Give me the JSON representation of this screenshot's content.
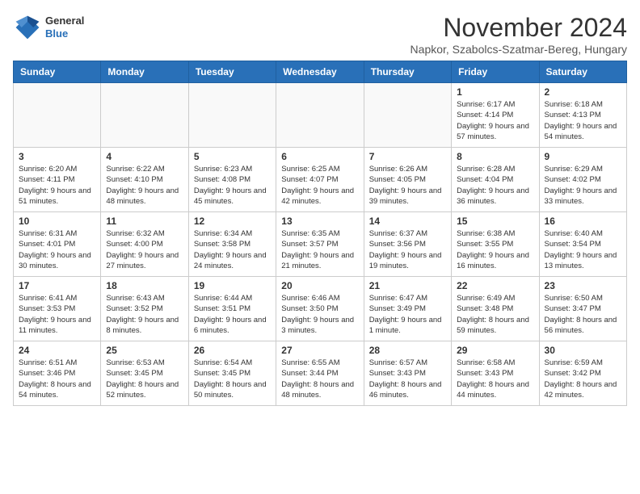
{
  "header": {
    "logo_line1": "General",
    "logo_line2": "Blue",
    "month": "November 2024",
    "location": "Napkor, Szabolcs-Szatmar-Bereg, Hungary"
  },
  "days_of_week": [
    "Sunday",
    "Monday",
    "Tuesday",
    "Wednesday",
    "Thursday",
    "Friday",
    "Saturday"
  ],
  "weeks": [
    [
      {
        "day": "",
        "info": ""
      },
      {
        "day": "",
        "info": ""
      },
      {
        "day": "",
        "info": ""
      },
      {
        "day": "",
        "info": ""
      },
      {
        "day": "",
        "info": ""
      },
      {
        "day": "1",
        "info": "Sunrise: 6:17 AM\nSunset: 4:14 PM\nDaylight: 9 hours\nand 57 minutes."
      },
      {
        "day": "2",
        "info": "Sunrise: 6:18 AM\nSunset: 4:13 PM\nDaylight: 9 hours\nand 54 minutes."
      }
    ],
    [
      {
        "day": "3",
        "info": "Sunrise: 6:20 AM\nSunset: 4:11 PM\nDaylight: 9 hours\nand 51 minutes."
      },
      {
        "day": "4",
        "info": "Sunrise: 6:22 AM\nSunset: 4:10 PM\nDaylight: 9 hours\nand 48 minutes."
      },
      {
        "day": "5",
        "info": "Sunrise: 6:23 AM\nSunset: 4:08 PM\nDaylight: 9 hours\nand 45 minutes."
      },
      {
        "day": "6",
        "info": "Sunrise: 6:25 AM\nSunset: 4:07 PM\nDaylight: 9 hours\nand 42 minutes."
      },
      {
        "day": "7",
        "info": "Sunrise: 6:26 AM\nSunset: 4:05 PM\nDaylight: 9 hours\nand 39 minutes."
      },
      {
        "day": "8",
        "info": "Sunrise: 6:28 AM\nSunset: 4:04 PM\nDaylight: 9 hours\nand 36 minutes."
      },
      {
        "day": "9",
        "info": "Sunrise: 6:29 AM\nSunset: 4:02 PM\nDaylight: 9 hours\nand 33 minutes."
      }
    ],
    [
      {
        "day": "10",
        "info": "Sunrise: 6:31 AM\nSunset: 4:01 PM\nDaylight: 9 hours\nand 30 minutes."
      },
      {
        "day": "11",
        "info": "Sunrise: 6:32 AM\nSunset: 4:00 PM\nDaylight: 9 hours\nand 27 minutes."
      },
      {
        "day": "12",
        "info": "Sunrise: 6:34 AM\nSunset: 3:58 PM\nDaylight: 9 hours\nand 24 minutes."
      },
      {
        "day": "13",
        "info": "Sunrise: 6:35 AM\nSunset: 3:57 PM\nDaylight: 9 hours\nand 21 minutes."
      },
      {
        "day": "14",
        "info": "Sunrise: 6:37 AM\nSunset: 3:56 PM\nDaylight: 9 hours\nand 19 minutes."
      },
      {
        "day": "15",
        "info": "Sunrise: 6:38 AM\nSunset: 3:55 PM\nDaylight: 9 hours\nand 16 minutes."
      },
      {
        "day": "16",
        "info": "Sunrise: 6:40 AM\nSunset: 3:54 PM\nDaylight: 9 hours\nand 13 minutes."
      }
    ],
    [
      {
        "day": "17",
        "info": "Sunrise: 6:41 AM\nSunset: 3:53 PM\nDaylight: 9 hours\nand 11 minutes."
      },
      {
        "day": "18",
        "info": "Sunrise: 6:43 AM\nSunset: 3:52 PM\nDaylight: 9 hours\nand 8 minutes."
      },
      {
        "day": "19",
        "info": "Sunrise: 6:44 AM\nSunset: 3:51 PM\nDaylight: 9 hours\nand 6 minutes."
      },
      {
        "day": "20",
        "info": "Sunrise: 6:46 AM\nSunset: 3:50 PM\nDaylight: 9 hours\nand 3 minutes."
      },
      {
        "day": "21",
        "info": "Sunrise: 6:47 AM\nSunset: 3:49 PM\nDaylight: 9 hours\nand 1 minute."
      },
      {
        "day": "22",
        "info": "Sunrise: 6:49 AM\nSunset: 3:48 PM\nDaylight: 8 hours\nand 59 minutes."
      },
      {
        "day": "23",
        "info": "Sunrise: 6:50 AM\nSunset: 3:47 PM\nDaylight: 8 hours\nand 56 minutes."
      }
    ],
    [
      {
        "day": "24",
        "info": "Sunrise: 6:51 AM\nSunset: 3:46 PM\nDaylight: 8 hours\nand 54 minutes."
      },
      {
        "day": "25",
        "info": "Sunrise: 6:53 AM\nSunset: 3:45 PM\nDaylight: 8 hours\nand 52 minutes."
      },
      {
        "day": "26",
        "info": "Sunrise: 6:54 AM\nSunset: 3:45 PM\nDaylight: 8 hours\nand 50 minutes."
      },
      {
        "day": "27",
        "info": "Sunrise: 6:55 AM\nSunset: 3:44 PM\nDaylight: 8 hours\nand 48 minutes."
      },
      {
        "day": "28",
        "info": "Sunrise: 6:57 AM\nSunset: 3:43 PM\nDaylight: 8 hours\nand 46 minutes."
      },
      {
        "day": "29",
        "info": "Sunrise: 6:58 AM\nSunset: 3:43 PM\nDaylight: 8 hours\nand 44 minutes."
      },
      {
        "day": "30",
        "info": "Sunrise: 6:59 AM\nSunset: 3:42 PM\nDaylight: 8 hours\nand 42 minutes."
      }
    ]
  ]
}
